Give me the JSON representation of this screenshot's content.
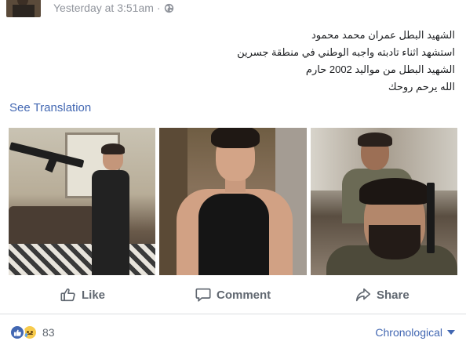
{
  "post": {
    "timestamp": "Yesterday at 3:51am",
    "separator": "·",
    "privacy_icon": "globe-icon",
    "text_lines": [
      "الشهيد البطل عمران محمد محمود",
      "استشهد اثناء تادبته واجبه الوطني في منطقة جسرين",
      "الشهيد البطل من مواليد 2002 حارم",
      "الله يرحم روحك"
    ],
    "see_translation": "See Translation"
  },
  "photos": [
    {
      "name": "photo-1"
    },
    {
      "name": "photo-2"
    },
    {
      "name": "photo-3"
    }
  ],
  "actions": {
    "like_label": "Like",
    "comment_label": "Comment",
    "share_label": "Share"
  },
  "footer": {
    "reaction_icons": [
      "like-reaction-icon",
      "sad-reaction-icon"
    ],
    "reaction_count": "83",
    "sort_label": "Chronological"
  },
  "colors": {
    "link": "#4267b2",
    "muted": "#90949c",
    "action_text": "#606770"
  }
}
